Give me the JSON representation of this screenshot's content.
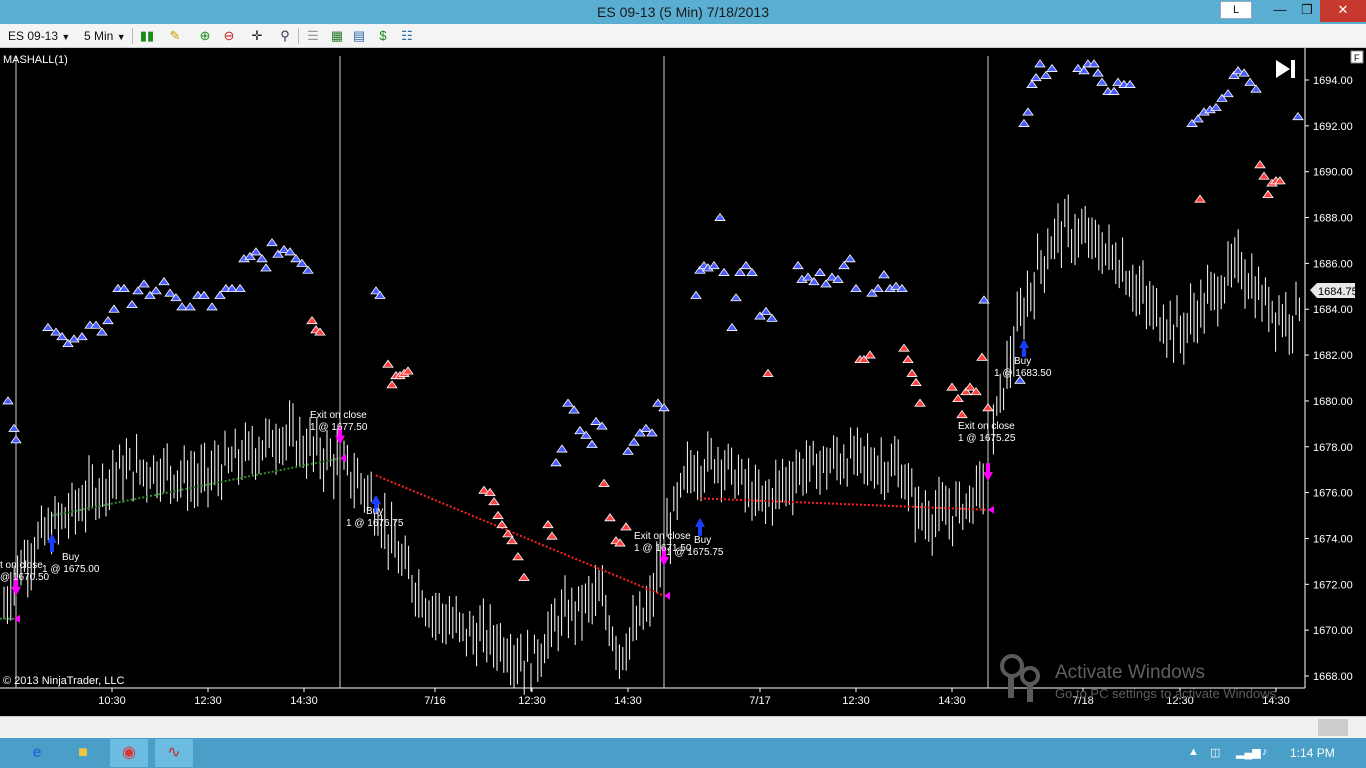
{
  "window": {
    "title": "ES 09-13 (5 Min)  7/18/2013",
    "link_button": "L",
    "min_icon": "minimize-icon",
    "max_icon": "maximize-icon",
    "close_icon": "close-icon"
  },
  "toolbar": {
    "instrument": "ES 09-13",
    "interval": "5 Min",
    "icons": [
      "bar-style-icon",
      "draw-pencil-icon",
      "zoom-in-icon",
      "zoom-out-icon",
      "crosshair-icon",
      "magnifier-icon",
      "strategy-icon",
      "indicator-icon",
      "chart-icon",
      "money-icon",
      "properties-icon"
    ]
  },
  "chart": {
    "indicator_label": "MASHALL(1)",
    "copyright": "© 2013 NinjaTrader, LLC",
    "f_button": "F",
    "skip_end_icon": "skip-to-end-icon",
    "last_price": "1684.75",
    "price_axis": [
      "1694.00",
      "1692.00",
      "1690.00",
      "1688.00",
      "1686.00",
      "1684.00",
      "1682.00",
      "1680.00",
      "1678.00",
      "1676.00",
      "1674.00",
      "1672.00",
      "1670.00",
      "1668.00"
    ],
    "time_axis": [
      "10:30",
      "12:30",
      "14:30",
      "7/16",
      "12:30",
      "14:30",
      "7/17",
      "12:30",
      "14:30",
      "7/18",
      "12:30",
      "14:30"
    ],
    "trade_labels": [
      {
        "line1": "t on close",
        "line2": "@ 1670.50"
      },
      {
        "line1": "Buy",
        "line2": "1 @ 1675.00"
      },
      {
        "line1": "Exit on close",
        "line2": "1 @ 1677.50"
      },
      {
        "line1": "Buy",
        "line2": "1 @ 1676.75"
      },
      {
        "line1": "Exit on close",
        "line2": "1 @ 1671.50"
      },
      {
        "line1": "Buy",
        "line2": "1 @ 1675.75"
      },
      {
        "line1": "Exit on close",
        "line2": "1 @ 1675.25"
      },
      {
        "line1": "Buy",
        "line2": "1 @ 1683.50"
      }
    ],
    "colors": {
      "up_marker": "#4a5cff",
      "down_marker": "#ff4040",
      "exit_arrow": "#ff00ff",
      "buy_arrow": "#1a3cff",
      "win_trade_line": "#2e8b2e",
      "loss_trade_line": "#ff2020"
    }
  },
  "watermark": {
    "line1": "Activate Windows",
    "line2": "Go to PC settings to activate Windows."
  },
  "taskbar": {
    "apps": [
      "ie-icon",
      "explorer-icon",
      "chrome-icon",
      "ninjatrader-icon"
    ],
    "clock": "1:14 PM"
  }
}
